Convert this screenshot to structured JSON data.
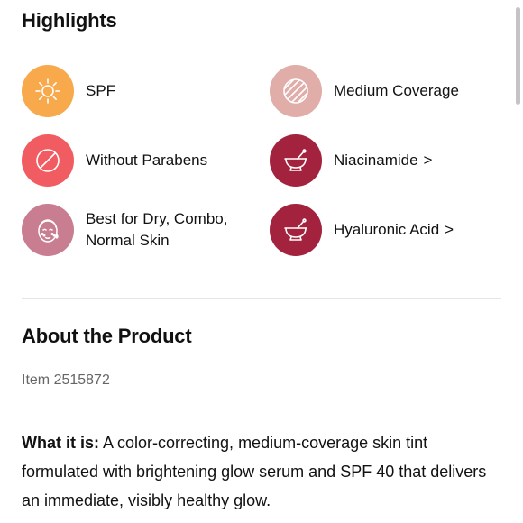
{
  "highlights": {
    "title": "Highlights",
    "items": [
      {
        "label": "SPF",
        "icon": "sun-icon",
        "color": "#F7A94B",
        "has_chevron": false
      },
      {
        "label": "Medium Coverage",
        "icon": "coverage-pattern-icon",
        "color": "#E0ADA8",
        "has_chevron": false
      },
      {
        "label": "Without Parabens",
        "icon": "prohibited-icon",
        "color": "#F05C61",
        "has_chevron": false
      },
      {
        "label": "Niacinamide",
        "icon": "mortar-pestle-icon",
        "color": "#A3233E",
        "has_chevron": true,
        "chevron": ">"
      },
      {
        "label": "Best for Dry, Combo, Normal Skin",
        "icon": "face-skin-icon",
        "color": "#C97D90",
        "has_chevron": false
      },
      {
        "label": "Hyaluronic Acid",
        "icon": "mortar-pestle-icon",
        "color": "#A3233E",
        "has_chevron": true,
        "chevron": ">"
      }
    ]
  },
  "about": {
    "title": "About the Product",
    "item_number": "Item 2515872",
    "what_it_is_label": "What it is:",
    "what_it_is_text": " A color-correcting, medium-coverage skin tint formulated with brightening glow serum and SPF 40 that delivers an immediate, visibly healthy glow."
  }
}
